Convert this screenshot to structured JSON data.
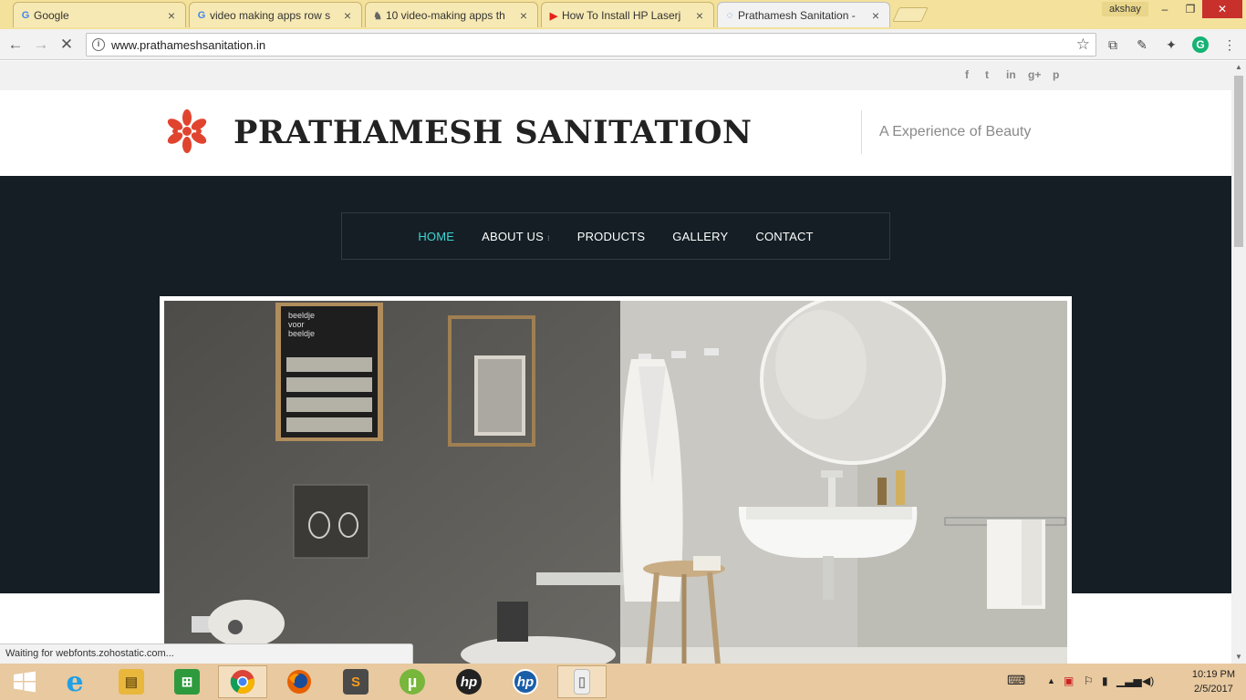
{
  "browser": {
    "tabs": [
      {
        "title": "Google",
        "favicon": "G",
        "fav_color": "#4285f4"
      },
      {
        "title": "video making apps row s",
        "favicon": "G",
        "fav_color": "#4285f4"
      },
      {
        "title": "10 video-making apps th",
        "favicon": "♞",
        "fav_color": "#666666"
      },
      {
        "title": "How To Install HP Laserj",
        "favicon": "▶",
        "fav_color": "#e62117"
      },
      {
        "title": "Prathamesh Sanitation -",
        "favicon": "◌",
        "fav_color": "#4a90d9"
      }
    ],
    "profile": "akshay",
    "close_tab": "×",
    "url": "www.prathameshsanitation.in",
    "back": "←",
    "forward": "→",
    "reload": "✕",
    "minimize": "–",
    "maximize": "❐",
    "close": "✕",
    "star": "☆",
    "extensions": [
      "⧉",
      "✎",
      "✦",
      "G",
      "⋮"
    ],
    "status": "Waiting for webfonts.zohostatic.com..."
  },
  "site": {
    "social": [
      "f",
      "t",
      "in",
      "g+",
      "p"
    ],
    "brand": "PRATHAMESH SANITATION",
    "tagline": "A Experience of Beauty",
    "logo_color": "#e0442f",
    "nav": [
      {
        "label": "HOME",
        "active": true
      },
      {
        "label": "ABOUT US",
        "dropdown": true
      },
      {
        "label": "PRODUCTS"
      },
      {
        "label": "GALLERY"
      },
      {
        "label": "CONTACT"
      }
    ],
    "nav_caret": "⁝",
    "nav_active_color": "#3ed6d3",
    "poster_text": [
      "beeldje",
      "voor",
      "beeldje"
    ],
    "hero_bg_color": "#141e24"
  },
  "taskbar": {
    "apps": [
      {
        "name": "windows-start",
        "label": ""
      },
      {
        "name": "internet-explorer",
        "label": "e"
      },
      {
        "name": "file-explorer",
        "label": "▤"
      },
      {
        "name": "windows-store",
        "label": "⊞"
      },
      {
        "name": "chrome",
        "label": ""
      },
      {
        "name": "firefox",
        "label": ""
      },
      {
        "name": "sublime-text",
        "label": "S"
      },
      {
        "name": "utorrent",
        "label": "µ"
      },
      {
        "name": "hp-app-1",
        "label": "hp"
      },
      {
        "name": "hp-app-2",
        "label": "hp"
      },
      {
        "name": "blank-app",
        "label": "▯"
      }
    ],
    "clock": {
      "time": "10:19 PM",
      "date": "2/5/2017"
    }
  }
}
